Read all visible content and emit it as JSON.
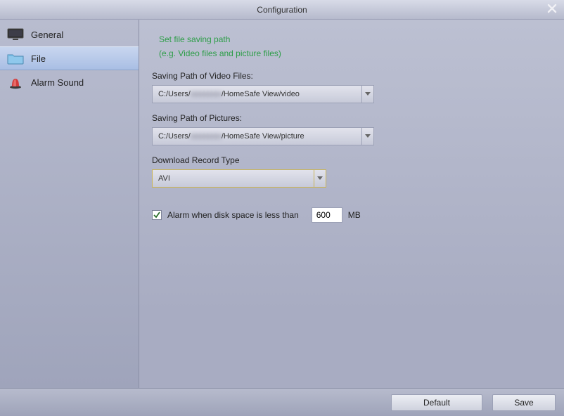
{
  "window": {
    "title": "Configuration"
  },
  "sidebar": {
    "items": [
      {
        "label": "General"
      },
      {
        "label": "File"
      },
      {
        "label": "Alarm Sound"
      }
    ],
    "active_index": 1
  },
  "main": {
    "heading_line1": "Set file saving path",
    "heading_line2": "(e.g. Video files and picture files)",
    "video_path": {
      "label": "Saving Path of Video Files:",
      "prefix": "C:/Users/",
      "redacted": "xxxxxxxx",
      "suffix": "/HomeSafe View/video"
    },
    "picture_path": {
      "label": "Saving Path of Pictures:",
      "prefix": "C:/Users/",
      "redacted": "xxxxxxxx",
      "suffix": "/HomeSafe View/picture"
    },
    "download_type": {
      "label": "Download Record Type",
      "value": "AVI"
    },
    "disk_alarm": {
      "checked": true,
      "label": "Alarm when disk space is less than",
      "value": "600",
      "unit": "MB"
    }
  },
  "footer": {
    "default_label": "Default",
    "save_label": "Save"
  }
}
